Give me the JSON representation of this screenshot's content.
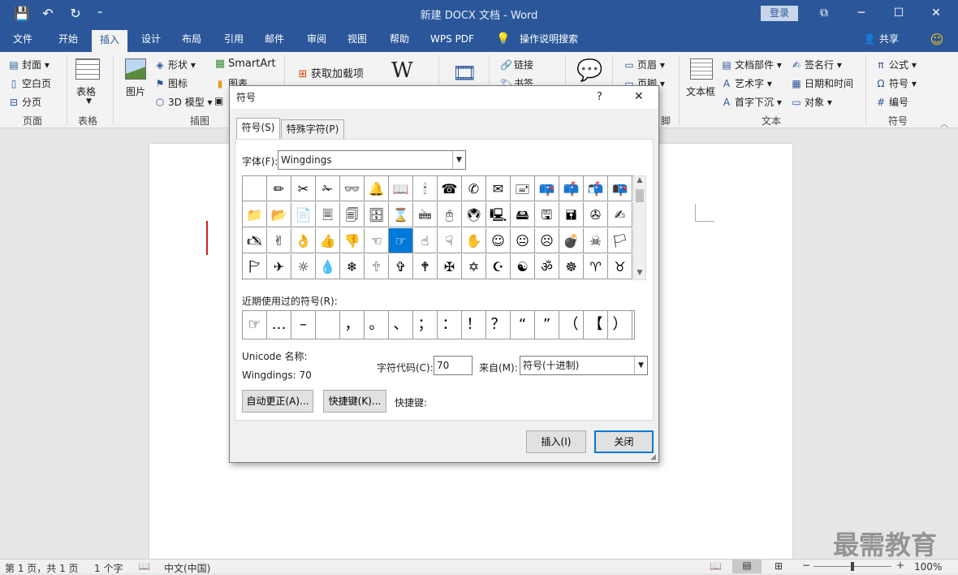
{
  "titlebar": {
    "qat": [
      "💾",
      "↶",
      "↻",
      "⁼"
    ],
    "title": "新建 DOCX 文档  -  Word",
    "login": "登录",
    "window_controls": [
      "⧉",
      "─",
      "☐",
      "✕"
    ]
  },
  "tabs": [
    "文件",
    "开始",
    "插入",
    "设计",
    "布局",
    "引用",
    "邮件",
    "审阅",
    "视图",
    "帮助",
    "WPS PDF",
    "操作说明搜索"
  ],
  "share": "共享",
  "ribbon": {
    "pages_group": {
      "items": [
        "封面",
        "空白页",
        "分页"
      ],
      "label": "页面"
    },
    "table_group": {
      "button": "表格",
      "label": "表格"
    },
    "illus_group": {
      "picture": "图片",
      "shapes": "形状",
      "icons": "图标",
      "model3d": "3D 模型",
      "smartart": "SmartArt",
      "chart": "图表",
      "label": "插图"
    },
    "addins": {
      "get": "获取加载项"
    },
    "links": {
      "link": "链接",
      "bookmark": "书签"
    },
    "header_footer": {
      "header": "页眉",
      "footer": "页脚",
      "label_fragment": "脚"
    },
    "text_group": {
      "textbox": "文本框",
      "quickparts": "文档部件",
      "wordart": "艺术字",
      "dropcap": "首字下沉",
      "signature": "签名行",
      "datetime": "日期和时间",
      "object": "对象",
      "label": "文本"
    },
    "symbols_group": {
      "equation": "公式",
      "symbol": "符号",
      "number": "编号",
      "label": "符号"
    }
  },
  "dialog": {
    "title": "符号",
    "help": "?",
    "close": "✕",
    "tabs": [
      "符号(S)",
      "特殊字符(P)"
    ],
    "font_label": "字体(F):",
    "font_value": "Wingdings",
    "grid": [
      [
        "",
        "✏",
        "✂",
        "✁",
        "👓",
        "🔔",
        "📖",
        "🕯",
        "☎",
        "✆",
        "✉",
        "🖃",
        "📪",
        "📫",
        "📬",
        "📭"
      ],
      [
        "📁",
        "📂",
        "📄",
        "🗏",
        "🗐",
        "🗄",
        "⌛",
        "🖮",
        "🖰",
        "🖲",
        "🖳",
        "🖴",
        "🖫",
        "🖬",
        "✇",
        "✍"
      ],
      [
        "🖎",
        "✌",
        "👌",
        "👍",
        "👎",
        "☜",
        "☞",
        "☝",
        "☟",
        "✋",
        "☺",
        "😐",
        "☹",
        "💣",
        "☠",
        "🏳"
      ],
      [
        "🏱",
        "✈",
        "☼",
        "💧",
        "❄",
        "🕆",
        "✞",
        "🕈",
        "✠",
        "✡",
        "☪",
        "☯",
        "ॐ",
        "☸",
        "♈",
        "♉"
      ]
    ],
    "selected_cell": [
      2,
      6
    ],
    "recent_label": "近期使用过的符号(R):",
    "recent": [
      "☞",
      "…",
      "–",
      " ",
      "，",
      "。",
      "、",
      "；",
      "：",
      "！",
      "？",
      "“",
      "”",
      "（",
      "【",
      "）"
    ],
    "unicode_name_label": "Unicode 名称:",
    "unicode_name_value": "Wingdings: 70",
    "char_code_label": "字符代码(C):",
    "char_code_value": "70",
    "from_label": "来自(M):",
    "from_value": "符号(十进制)",
    "autocorrect": "自动更正(A)...",
    "shortcut_key_btn": "快捷键(K)...",
    "shortcut_label": "快捷键:",
    "insert": "插入(I)",
    "close_btn": "关闭"
  },
  "status": {
    "page": "第 1 页，共 1 页",
    "words": "1 个字",
    "lang": "中文(中国)",
    "zoom": "100%"
  },
  "watermark": "最需教育",
  "colors": {
    "brand": "#2b579a",
    "select": "#0078d7"
  }
}
